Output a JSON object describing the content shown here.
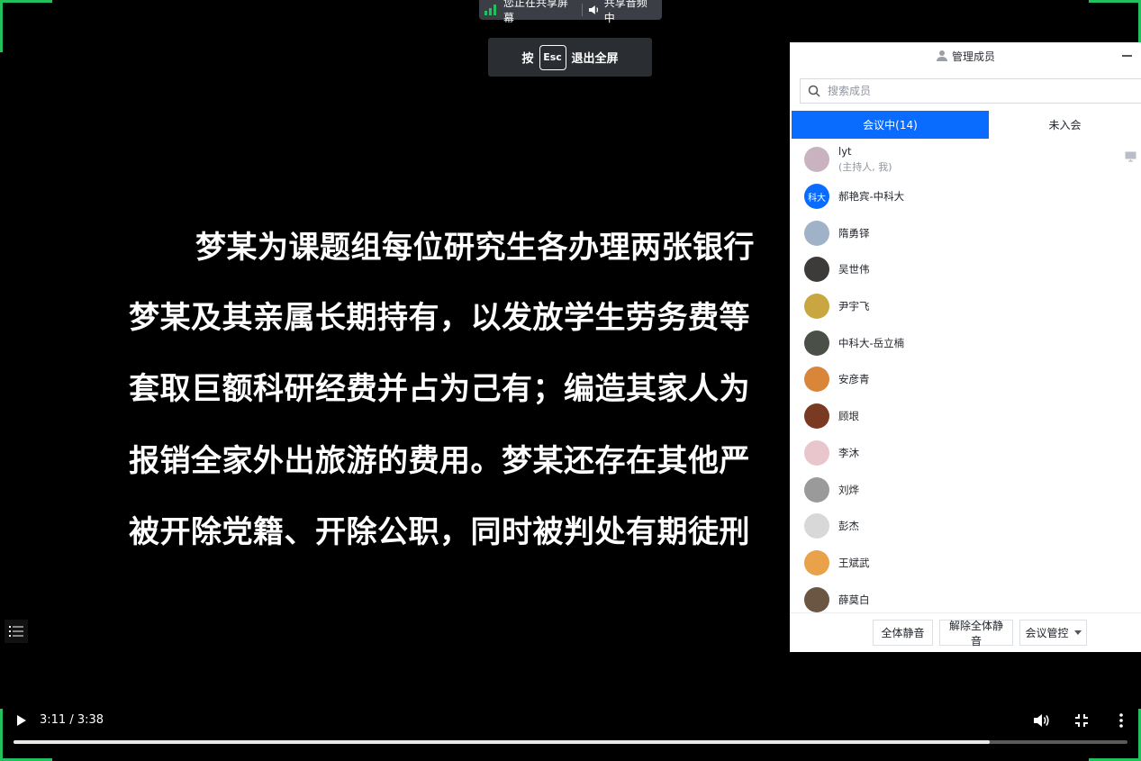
{
  "share_bar": {
    "sharing_screen": "您正在共享屏幕",
    "sharing_audio": "共享音频中"
  },
  "esc_hint": {
    "prefix": "按",
    "key": "Esc",
    "suffix": "退出全屏"
  },
  "slide": {
    "lines": [
      "梦某为课题组每位研究生各办理两张银行",
      "梦某及其亲属长期持有，以发放学生劳务费等",
      "套取巨额科研经费并占为己有；编造其家人为",
      "报销全家外出旅游的费用。梦某还存在其他严",
      "被开除党籍、开除公职，同时被判处有期徒刑"
    ]
  },
  "video": {
    "time": "3:11 / 3:38",
    "progress": 0.876
  },
  "panel": {
    "title": "管理成员",
    "search_placeholder": "搜索成员",
    "tab_in_meeting": "会议中(14)",
    "tab_not_joined": "未入会",
    "members": [
      {
        "name": "lyt",
        "sub": "(主持人, 我)",
        "color": "#c9b3c0"
      },
      {
        "name": "郝艳宾-中科大",
        "avatar_text": "科大",
        "color": "#0a6cff"
      },
      {
        "name": "隋勇铎",
        "color": "#9fb2c8"
      },
      {
        "name": "吴世伟",
        "color": "#3d3a3a"
      },
      {
        "name": "尹宇飞",
        "color": "#c9a640"
      },
      {
        "name": "中科大-岳立楠",
        "color": "#4a4f47"
      },
      {
        "name": "安彦青",
        "color": "#d9863b"
      },
      {
        "name": "顾垠",
        "color": "#7a3a22"
      },
      {
        "name": "李沐",
        "color": "#e9c6cc"
      },
      {
        "name": "刘烨",
        "color": "#9a9a9a"
      },
      {
        "name": "彭杰",
        "color": "#d8d8d8"
      },
      {
        "name": "王斌武",
        "color": "#e9a24a"
      },
      {
        "name": "薛莫白",
        "color": "#6b5643"
      }
    ],
    "footer": {
      "mute_all": "全体静音",
      "unmute_all": "解除全体静音",
      "meeting_control": "会议管控"
    }
  }
}
